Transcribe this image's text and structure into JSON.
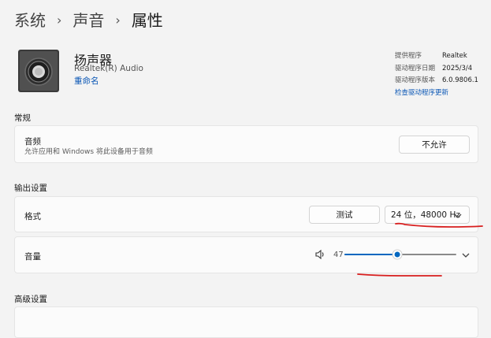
{
  "breadcrumb": {
    "items": [
      "系统",
      "声音",
      "属性"
    ]
  },
  "device": {
    "name": "扬声器",
    "driver_name": "Realtek(R) Audio",
    "rename_label": "重命名",
    "icon": "speaker-icon"
  },
  "driver_info": {
    "provider_label": "提供程序",
    "provider_value": "Realtek",
    "date_label": "驱动程序日期",
    "date_value": "2025/3/4",
    "version_label": "驱动程序版本",
    "version_value": "6.0.9806.1",
    "update_link": "检查驱动程序更新"
  },
  "general": {
    "title": "常规",
    "audio_label": "音频",
    "audio_desc": "允许应用和 Windows 将此设备用于音频",
    "allow_button": "不允许"
  },
  "output": {
    "title": "输出设置",
    "format_label": "格式",
    "test_button": "测试",
    "format_value": "24 位，48000 Hz",
    "volume_label": "音量",
    "volume_value": "47",
    "volume_level": 0.47
  },
  "advanced": {
    "title": "高级设置"
  },
  "colors": {
    "accent": "#0067c0",
    "link": "#0b57b5",
    "annotation": "#d81e1e"
  }
}
